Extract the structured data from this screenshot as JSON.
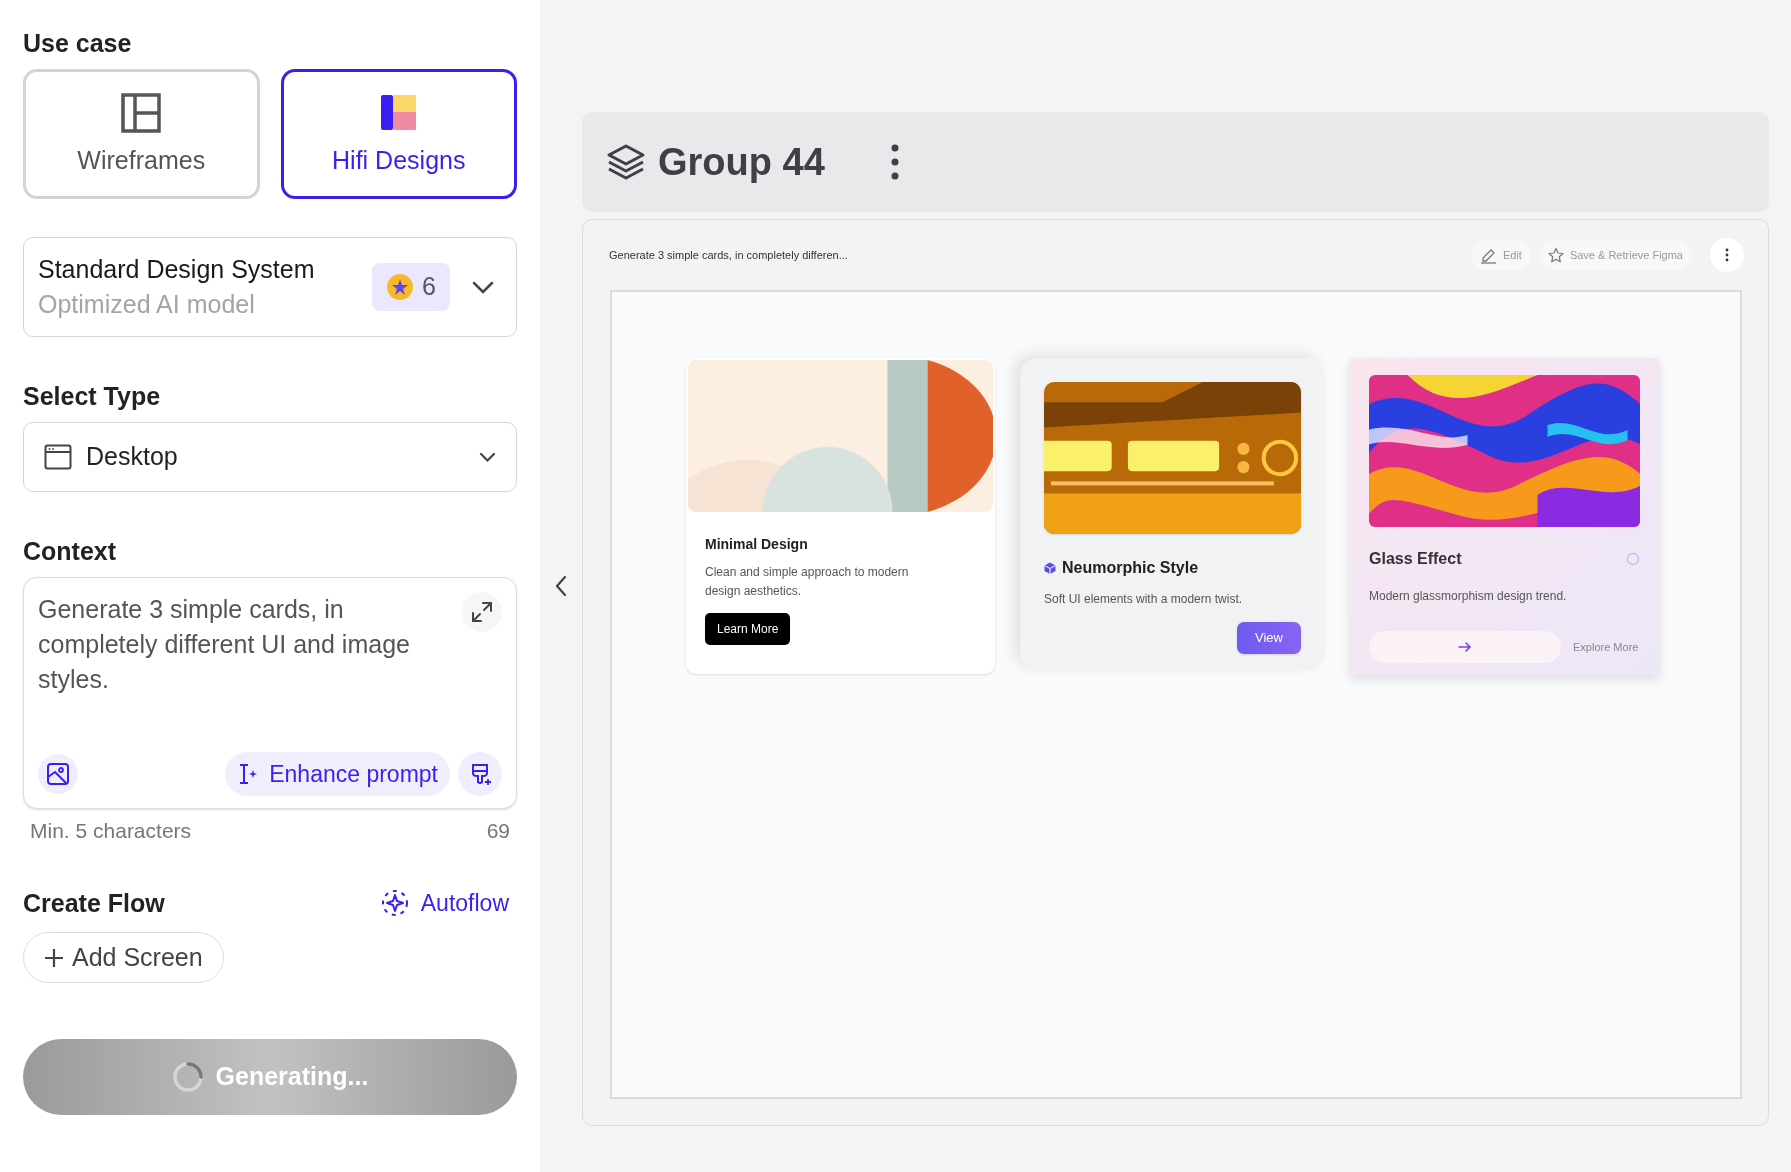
{
  "use_case": {
    "title": "Use case",
    "options": [
      {
        "kind": "wireframe",
        "label": "Wireframes",
        "selected": false
      },
      {
        "kind": "hifi",
        "label": "Hifi Designs",
        "selected": true
      }
    ]
  },
  "design_system": {
    "name": "Standard Design System",
    "subtitle": "Optimized AI model",
    "credits": "6"
  },
  "select_type": {
    "title": "Select Type",
    "value": "Desktop"
  },
  "context": {
    "title": "Context",
    "value": "Generate 3 simple cards, in completely different UI and image styles.",
    "enhance_label": "Enhance prompt",
    "hint": "Min. 5 characters",
    "count": "69"
  },
  "create_flow": {
    "title": "Create Flow",
    "autoflow_label": "Autoflow",
    "add_screen_label": "Add Screen"
  },
  "generate_button": {
    "label": "Generating...",
    "loading": true
  },
  "group": {
    "title": "Group 44"
  },
  "preview": {
    "prompt": "Generate 3 simple cards, in completely differen...",
    "actions": [
      {
        "kind": "edit",
        "label": "Edit"
      },
      {
        "kind": "star",
        "label": "Save & Retrieve Figma"
      }
    ],
    "cards": [
      {
        "kind": "minimal",
        "title": "Minimal Design",
        "description": "Clean and simple approach to modern design aesthetics.",
        "button": "Learn More"
      },
      {
        "kind": "neumorphic",
        "title": "Neumorphic Style",
        "description": "Soft UI elements with a modern twist.",
        "button": "View"
      },
      {
        "kind": "glass",
        "title": "Glass Effect",
        "description": "Modern glassmorphism design trend.",
        "link": "Explore More"
      }
    ]
  }
}
